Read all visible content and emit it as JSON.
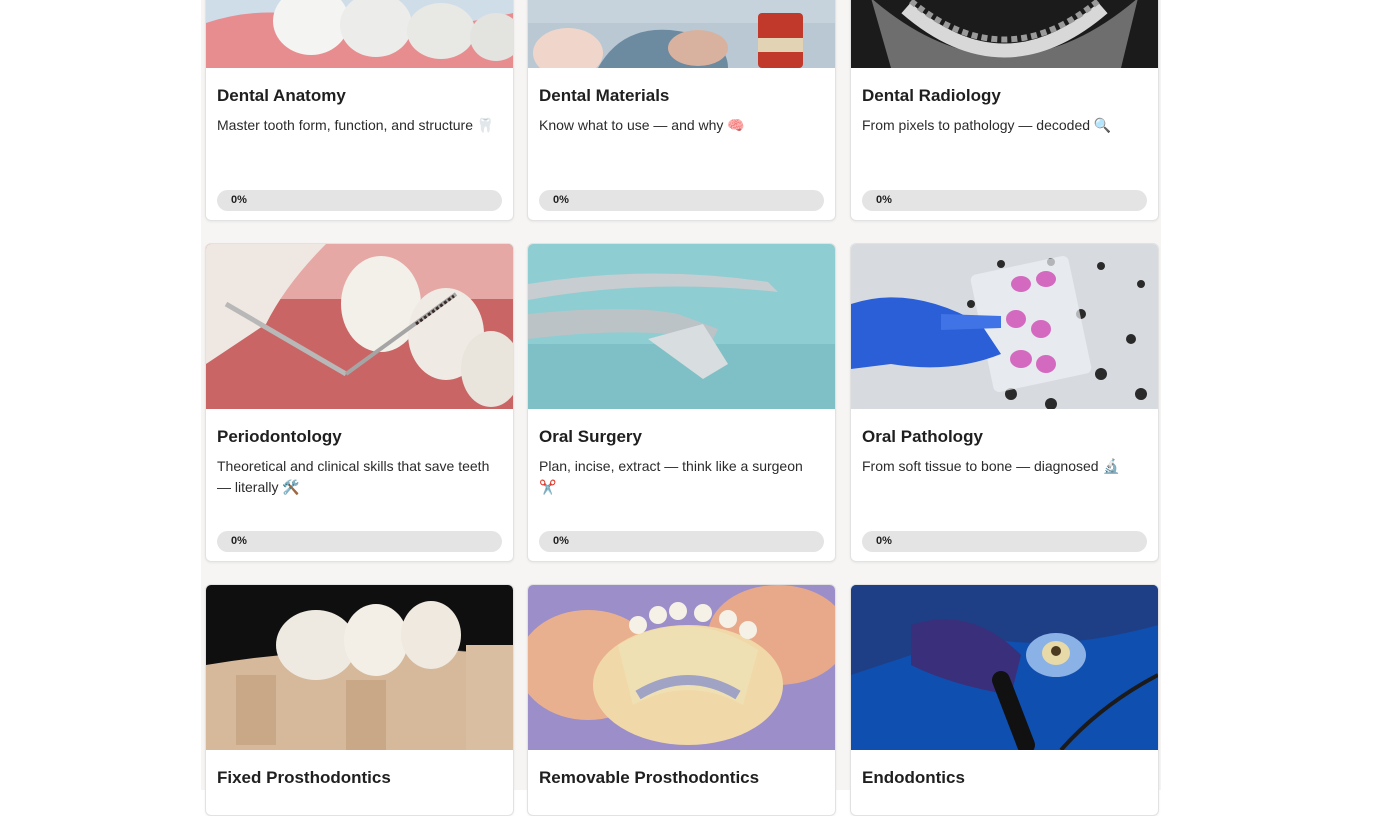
{
  "courses": [
    {
      "title": "Dental Anatomy",
      "description": "Master tooth form, function, and structure",
      "emoji": "🦷",
      "emoji_icon": "tooth-icon",
      "progress_label": "0%",
      "progress": 0
    },
    {
      "title": "Dental Materials",
      "description": "Know what to use — and why",
      "emoji": "🧠",
      "emoji_icon": "brain-icon",
      "progress_label": "0%",
      "progress": 0
    },
    {
      "title": "Dental Radiology",
      "description": "From pixels to pathology — decoded",
      "emoji": "🔍",
      "emoji_icon": "magnifier-icon",
      "progress_label": "0%",
      "progress": 0
    },
    {
      "title": "Periodontology",
      "description": "Theoretical and clinical skills that save teeth — literally",
      "emoji": "🛠️",
      "emoji_icon": "tools-icon",
      "progress_label": "0%",
      "progress": 0
    },
    {
      "title": "Oral Surgery",
      "description": "Plan, incise, extract — think like a surgeon",
      "emoji": "✂️",
      "emoji_icon": "scissors-icon",
      "progress_label": "0%",
      "progress": 0
    },
    {
      "title": "Oral Pathology",
      "description": "From soft tissue to bone — diagnosed",
      "emoji": "🔬",
      "emoji_icon": "microscope-icon",
      "progress_label": "0%",
      "progress": 0
    },
    {
      "title": "Fixed Prosthodontics"
    },
    {
      "title": "Removable Prosthodontics"
    },
    {
      "title": "Endodontics"
    }
  ],
  "colors": {
    "page_bg": "#f6f5f3",
    "card_bg": "#ffffff",
    "progress_track": "#e4e4e4"
  }
}
